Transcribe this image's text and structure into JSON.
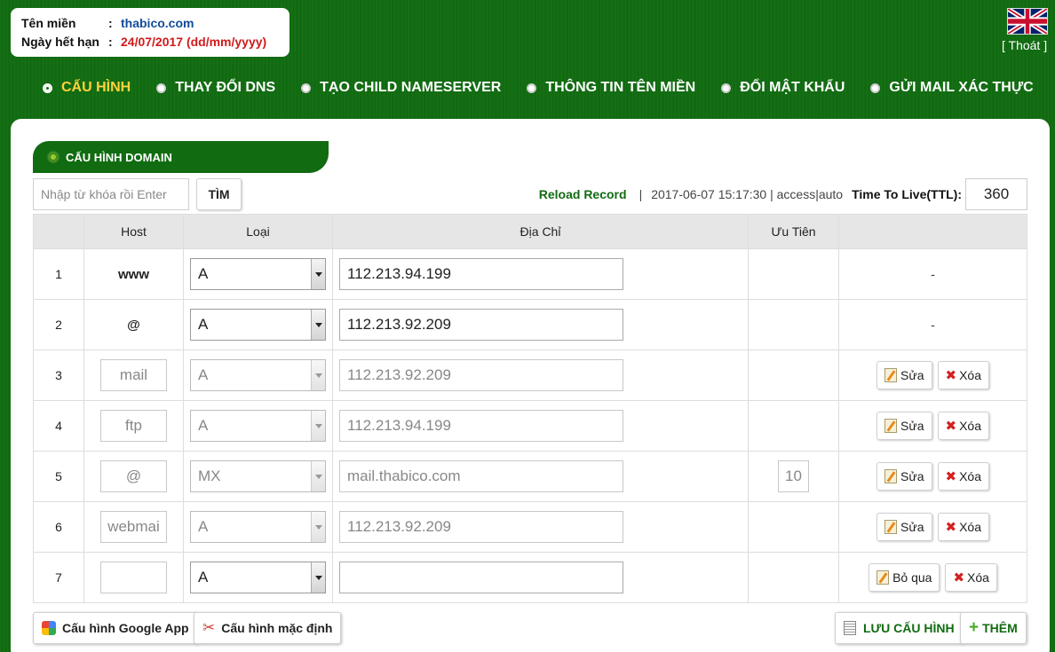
{
  "domain_info": {
    "domain_label": "Tên miền",
    "domain_value": "thabico.com",
    "expiry_label": "Ngày hết hạn",
    "expiry_value": "24/07/2017 (dd/mm/yyyy)",
    "separator": ":"
  },
  "header": {
    "logout_label": "[ Thoát ]"
  },
  "nav": [
    {
      "label": "CẤU HÌNH",
      "active": true
    },
    {
      "label": "THAY ĐỔI DNS",
      "active": false
    },
    {
      "label": "TẠO CHILD NAMESERVER",
      "active": false
    },
    {
      "label": "THÔNG TIN TÊN MIỀN",
      "active": false
    },
    {
      "label": "ĐỔI MẬT KHẨU",
      "active": false
    },
    {
      "label": "GỬI MAIL XÁC THỰC",
      "active": false
    }
  ],
  "section": {
    "title": "CẤU HÌNH DOMAIN"
  },
  "search": {
    "placeholder": "Nhập từ khóa rồi Enter",
    "button_label": "TÌM"
  },
  "status": {
    "reload_label": "Reload Record",
    "pipe": "|",
    "timestamp": "2017-06-07 15:17:30 | access|auto",
    "ttl_label": "Time To Live(TTL):",
    "ttl_value": "360"
  },
  "table": {
    "headers": [
      "",
      "Host",
      "Loại",
      "Địa Chỉ",
      "Ưu Tiên",
      ""
    ],
    "rows": [
      {
        "num": "1",
        "host": "www",
        "type": "A",
        "address": "112.213.94.199",
        "priority": "",
        "action": "-"
      },
      {
        "num": "2",
        "host": "@",
        "type": "A",
        "address": "112.213.92.209",
        "priority": "",
        "action": "-"
      },
      {
        "num": "3",
        "host": "mail",
        "type": "A",
        "address": "112.213.92.209",
        "priority": "",
        "edit": "Sửa",
        "delete": "Xóa"
      },
      {
        "num": "4",
        "host": "ftp",
        "type": "A",
        "address": "112.213.94.199",
        "priority": "",
        "edit": "Sửa",
        "delete": "Xóa"
      },
      {
        "num": "5",
        "host": "@",
        "type": "MX",
        "address": "mail.thabico.com",
        "priority": "10",
        "edit": "Sửa",
        "delete": "Xóa"
      },
      {
        "num": "6",
        "host": "webmai",
        "type": "A",
        "address": "112.213.92.209",
        "priority": "",
        "edit": "Sửa",
        "delete": "Xóa"
      },
      {
        "num": "7",
        "host": "",
        "type": "A",
        "address": "",
        "priority": "",
        "skip": "Bỏ qua",
        "delete": "Xóa"
      }
    ]
  },
  "buttons": {
    "google_app": "Cấu hình Google App",
    "default_config": "Cấu hình mặc định",
    "save": "LƯU CẤU HÌNH",
    "add": "THÊM"
  },
  "colors": {
    "background": "#116b11",
    "active_nav": "#ffd23a",
    "domain_blue": "#124c9a",
    "expiry_red": "#d21a1a"
  }
}
